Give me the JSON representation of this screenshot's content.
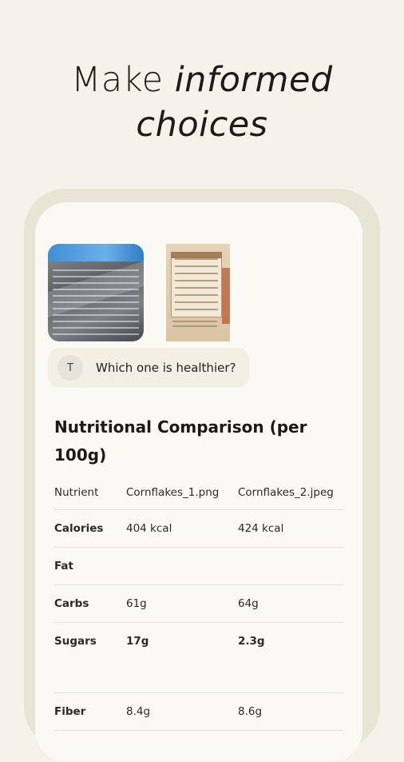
{
  "headline": {
    "normal": "Make ",
    "italic_1": "informed",
    "italic_2": "choices"
  },
  "chat": {
    "avatar_letter": "T",
    "question": "Which one is healthier?"
  },
  "section_title": "Nutritional Comparison (per 100g)",
  "table": {
    "headers": [
      "Nutrient",
      "Cornflakes_1.png",
      "Cornflakes_2.jpeg"
    ],
    "rows": [
      {
        "nutrient": "Calories",
        "v1": "404 kcal",
        "v2": "424 kcal"
      },
      {
        "nutrient": "Fat",
        "v1": "",
        "v2": ""
      },
      {
        "nutrient": "Carbs",
        "v1": "61g",
        "v2": "64g"
      },
      {
        "nutrient": "Sugars",
        "v1": "17g",
        "v2": "2.3g"
      },
      {
        "nutrient": "Fiber",
        "v1": "8.4g",
        "v2": "8.6g"
      }
    ]
  },
  "colors": {
    "background": "#f5f2e9",
    "card": "#fbf9f4",
    "frame": "#e9e5d6"
  }
}
